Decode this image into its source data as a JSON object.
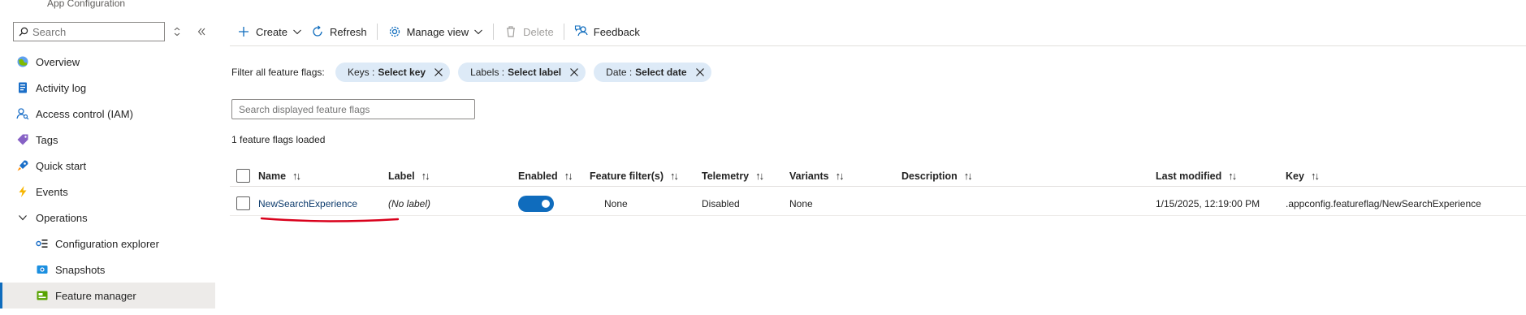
{
  "app": {
    "title": "App Configuration"
  },
  "sidebar": {
    "search_placeholder": "Search",
    "items": [
      {
        "label": "Overview",
        "icon": "overview-icon"
      },
      {
        "label": "Activity log",
        "icon": "activity-log-icon"
      },
      {
        "label": "Access control (IAM)",
        "icon": "access-control-icon"
      },
      {
        "label": "Tags",
        "icon": "tag-icon"
      },
      {
        "label": "Quick start",
        "icon": "quick-start-icon"
      },
      {
        "label": "Events",
        "icon": "lightning-icon"
      },
      {
        "label": "Operations",
        "icon": "chevron-down-icon"
      },
      {
        "label": "Configuration explorer",
        "icon": "config-explorer-icon"
      },
      {
        "label": "Snapshots",
        "icon": "snapshot-icon"
      },
      {
        "label": "Feature manager",
        "icon": "feature-manager-icon"
      }
    ]
  },
  "toolbar": {
    "create": "Create",
    "refresh": "Refresh",
    "manage_view": "Manage view",
    "delete": "Delete",
    "feedback": "Feedback"
  },
  "filters": {
    "label": "Filter all feature flags:",
    "pills": [
      {
        "name": "Keys :",
        "value": "Select key"
      },
      {
        "name": "Labels :",
        "value": "Select label"
      },
      {
        "name": "Date :",
        "value": "Select date"
      }
    ]
  },
  "search_flags_placeholder": "Search displayed feature flags",
  "loaded_text": "1 feature flags loaded",
  "table": {
    "headers": {
      "name": "Name",
      "label": "Label",
      "enabled": "Enabled",
      "feature_filters": "Feature filter(s)",
      "telemetry": "Telemetry",
      "variants": "Variants",
      "description": "Description",
      "last_modified": "Last modified",
      "key": "Key"
    },
    "sort_glyph": "↑↓",
    "rows": [
      {
        "name": "NewSearchExperience",
        "label": "(No label)",
        "enabled": true,
        "feature_filters": "None",
        "telemetry": "Disabled",
        "variants": "None",
        "description": "",
        "last_modified": "1/15/2025, 12:19:00 PM",
        "key": ".appconfig.featureflag/NewSearchExperience"
      }
    ]
  },
  "colors": {
    "accent": "#0f6cbd",
    "pill_bg": "#ddeaf7",
    "annotation_red": "#d9001b"
  }
}
